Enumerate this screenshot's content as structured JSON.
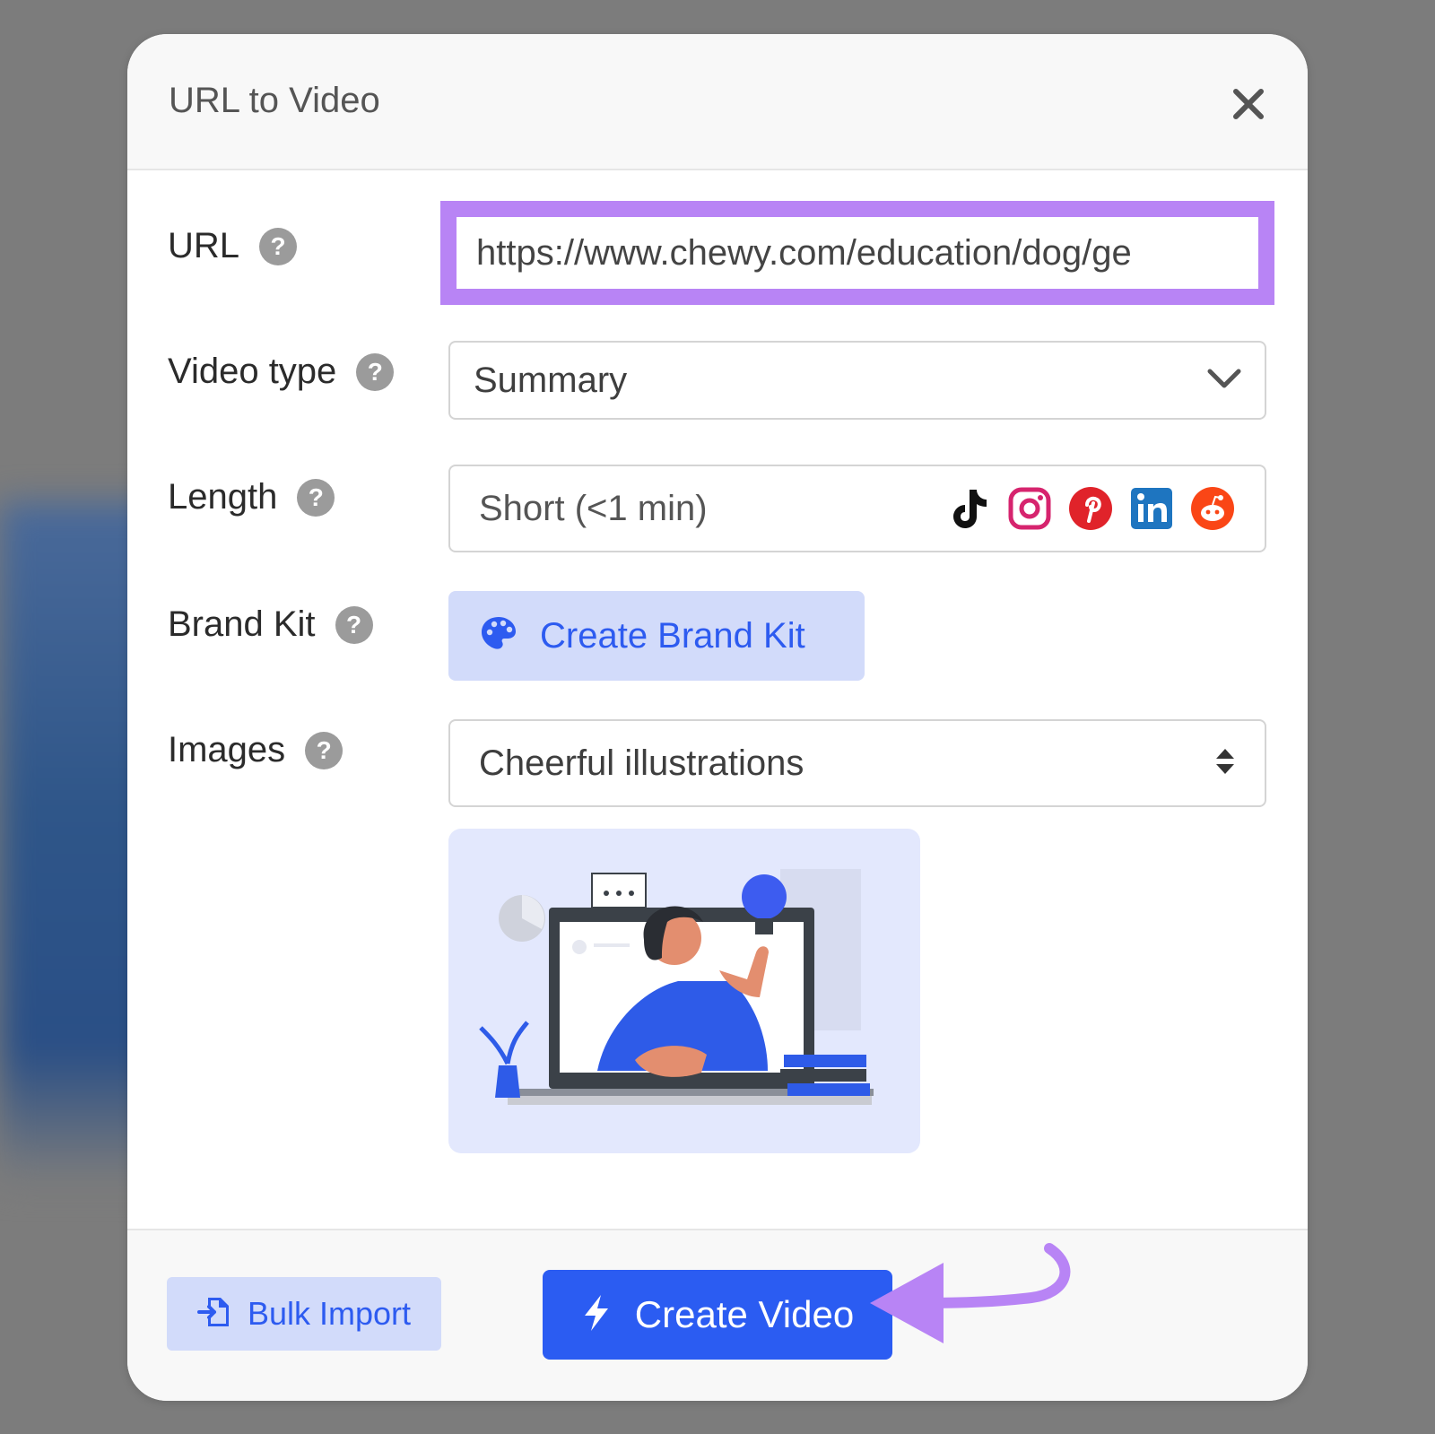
{
  "dialog": {
    "title": "URL to Video"
  },
  "form": {
    "url": {
      "label": "URL",
      "value": "https://www.chewy.com/education/dog/ge"
    },
    "video_type": {
      "label": "Video type",
      "value": "Summary"
    },
    "length": {
      "label": "Length",
      "value": "Short (<1 min)",
      "platforms": [
        "tiktok-icon",
        "instagram-icon",
        "pinterest-icon",
        "linkedin-icon",
        "reddit-icon"
      ]
    },
    "brand_kit": {
      "label": "Brand Kit",
      "button_label": "Create Brand Kit"
    },
    "images": {
      "label": "Images",
      "value": "Cheerful illustrations"
    }
  },
  "footer": {
    "bulk_import_label": "Bulk Import",
    "create_video_label": "Create Video"
  },
  "colors": {
    "accent": "#2b5cf2",
    "highlight": "#b884f5",
    "button_light": "#d2dbfa"
  }
}
